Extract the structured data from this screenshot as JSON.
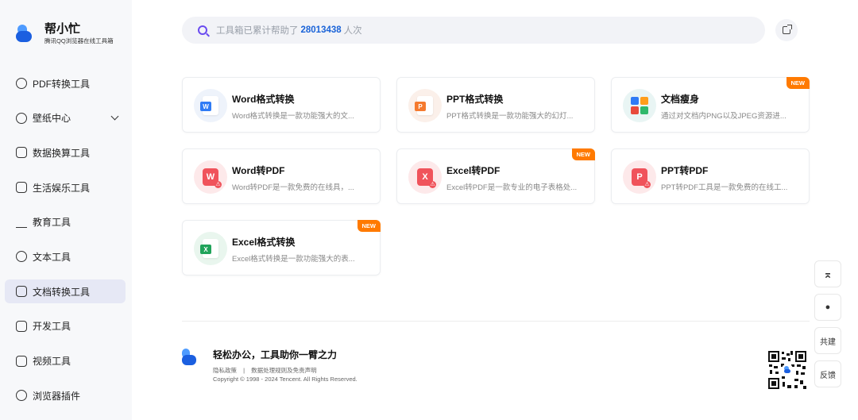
{
  "brand": {
    "title": "帮小忙",
    "subtitle": "腾讯QQ浏览器在线工具箱"
  },
  "sidebar": {
    "items": [
      {
        "label": "PDF转换工具",
        "icon": "pdf-icon"
      },
      {
        "label": "壁纸中心",
        "icon": "wallpaper-icon",
        "expandable": true
      },
      {
        "label": "数据换算工具",
        "icon": "calculator-icon"
      },
      {
        "label": "生活娱乐工具",
        "icon": "game-icon"
      },
      {
        "label": "教育工具",
        "icon": "education-icon"
      },
      {
        "label": "文本工具",
        "icon": "text-icon"
      },
      {
        "label": "文档转换工具",
        "icon": "doc-convert-icon",
        "active": true
      },
      {
        "label": "开发工具",
        "icon": "code-icon"
      },
      {
        "label": "视频工具",
        "icon": "video-icon"
      },
      {
        "label": "浏览器插件",
        "icon": "plugin-icon"
      }
    ]
  },
  "search": {
    "prefix": "工具箱已累计帮助了",
    "count": "28013438",
    "suffix": "人次"
  },
  "cards": [
    {
      "title": "Word格式转换",
      "desc": "Word格式转换是一款功能强大的文...",
      "icon": "word-doc-icon",
      "badge": ""
    },
    {
      "title": "PPT格式转换",
      "desc": "PPT格式转换是一款功能强大的幻灯...",
      "icon": "ppt-doc-icon",
      "badge": ""
    },
    {
      "title": "文档瘦身",
      "desc": "通过对文档内PNG以及JPEG资源进...",
      "icon": "doc-slim-icon",
      "badge": "NEW"
    },
    {
      "title": "Word转PDF",
      "desc": "Word转PDF是一款免费的在线具，...",
      "icon": "word-pdf-icon",
      "badge": ""
    },
    {
      "title": "Excel转PDF",
      "desc": "Excel转PDF是一款专业的电子表格处...",
      "icon": "excel-pdf-icon",
      "badge": "NEW"
    },
    {
      "title": "PPT转PDF",
      "desc": "PPT转PDF工具是一款免费的在线工...",
      "icon": "ppt-pdf-icon",
      "badge": ""
    },
    {
      "title": "Excel格式转换",
      "desc": "Excel格式转换是一款功能强大的表...",
      "icon": "excel-doc-icon",
      "badge": "NEW"
    }
  ],
  "footer": {
    "slogan": "轻松办公，工具助你一臂之力",
    "link_privacy": "隐私政策",
    "link_sep": "|",
    "link_data": "数据处理规则及免责声明",
    "copyright": "Copyright © 1998 - 2024 Tencent. All Rights Reserved."
  },
  "float_buttons": {
    "top": "⌅",
    "qq": "●",
    "cobuild": "共建",
    "feedback": "反馈"
  },
  "colors": {
    "accent": "#1a63d8",
    "badge": "#ff7a00",
    "search_icon": "#6a4bf0",
    "active_nav": "#e6e8f5"
  }
}
